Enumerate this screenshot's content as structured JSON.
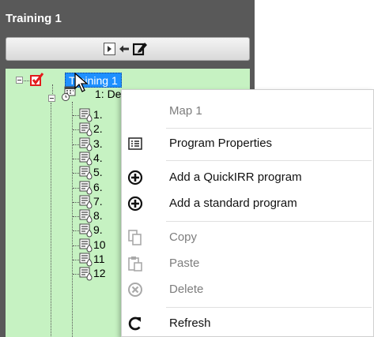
{
  "panel": {
    "title": "Training 1",
    "toolbar": {
      "icons": [
        "play-box-icon",
        "arrow-left-icon",
        "edit-icon"
      ]
    }
  },
  "tree": {
    "root": {
      "label": "Training 1",
      "checked": true,
      "icon": "red-check-icon"
    },
    "child": {
      "label": "1: Dee",
      "icon": "schedule-icon"
    },
    "programs": [
      "1.",
      "2.",
      "3.",
      "4.",
      "5.",
      "6.",
      "7.",
      "8.",
      "9.",
      "10",
      "11",
      "12"
    ]
  },
  "context_menu": {
    "title": "Map 1",
    "items": [
      {
        "label": "Program Properties",
        "icon": "list-icon",
        "enabled": true
      },
      {
        "label": "Add a QuickIRR program",
        "icon": "add-circle-icon",
        "enabled": true
      },
      {
        "label": "Add a standard program",
        "icon": "add-circle-icon",
        "enabled": true
      },
      {
        "label": "Copy",
        "icon": "copy-icon",
        "enabled": false
      },
      {
        "label": "Paste",
        "icon": "paste-icon",
        "enabled": false
      },
      {
        "label": "Delete",
        "icon": "delete-circle-icon",
        "enabled": false
      },
      {
        "label": "Refresh",
        "icon": "refresh-icon",
        "enabled": true
      }
    ]
  },
  "colors": {
    "panel_bg": "#595959",
    "tree_bg": "#c6f2c2",
    "selection": "#1e90ff",
    "check_red": "#e31b1b"
  }
}
